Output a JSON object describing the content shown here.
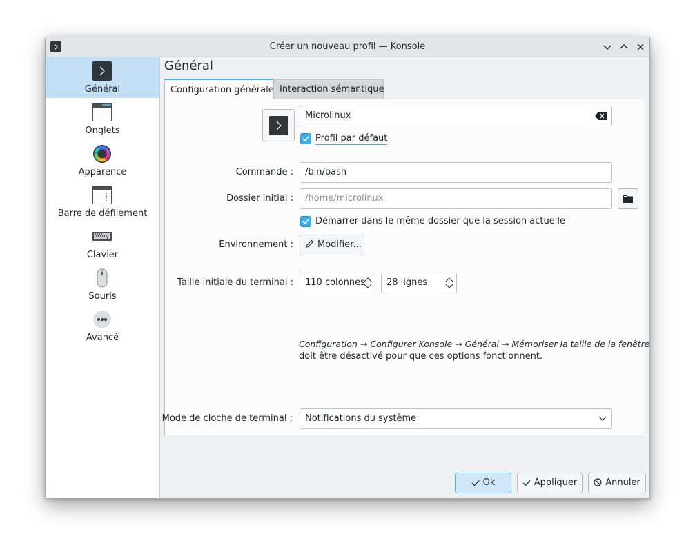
{
  "window": {
    "title": "Créer un nouveau profil — Konsole"
  },
  "sidebar": {
    "items": [
      {
        "label": "Général",
        "icon": "terminal-icon",
        "active": true
      },
      {
        "label": "Onglets",
        "icon": "tabs-icon"
      },
      {
        "label": "Apparence",
        "icon": "color-wheel-icon"
      },
      {
        "label": "Barre de défilement",
        "icon": "scrollbar-icon"
      },
      {
        "label": "Clavier",
        "icon": "keyboard-icon"
      },
      {
        "label": "Souris",
        "icon": "mouse-icon"
      },
      {
        "label": "Avancé",
        "icon": "more-icon"
      }
    ]
  },
  "page": {
    "title": "Général"
  },
  "tabs": [
    {
      "label": "Configuration générale",
      "active": true
    },
    {
      "label": "Interaction sémantique",
      "active": false
    }
  ],
  "form": {
    "profile_name": "Microlinux",
    "default_profile_label": "Profil par défaut",
    "command_label": "Commande :",
    "command_value": "/bin/bash",
    "initial_dir_label": "Dossier initial :",
    "initial_dir_placeholder": "/home/microlinux",
    "start_same_dir_label": "Démarrer dans le même dossier que la session actuelle",
    "environment_label": "Environnement :",
    "modify_button": "Modifier...",
    "terminal_size_label": "Taille initiale du terminal :",
    "columns_value": "110 colonnes",
    "lines_value": "28 lignes",
    "note_italic": "Configuration → Configurer Konsole → Général → Mémoriser la taille de la fenêtre",
    "note_rest": "doit être désactivé pour que ces options fonctionnent.",
    "bell_mode_label": "Mode de cloche de terminal :",
    "bell_mode_value": "Notifications du système"
  },
  "footer": {
    "ok": "Ok",
    "apply": "Appliquer",
    "cancel": "Annuler"
  },
  "colors": {
    "accent": "#3daee9",
    "sidebar_active": "#c2dff3"
  }
}
